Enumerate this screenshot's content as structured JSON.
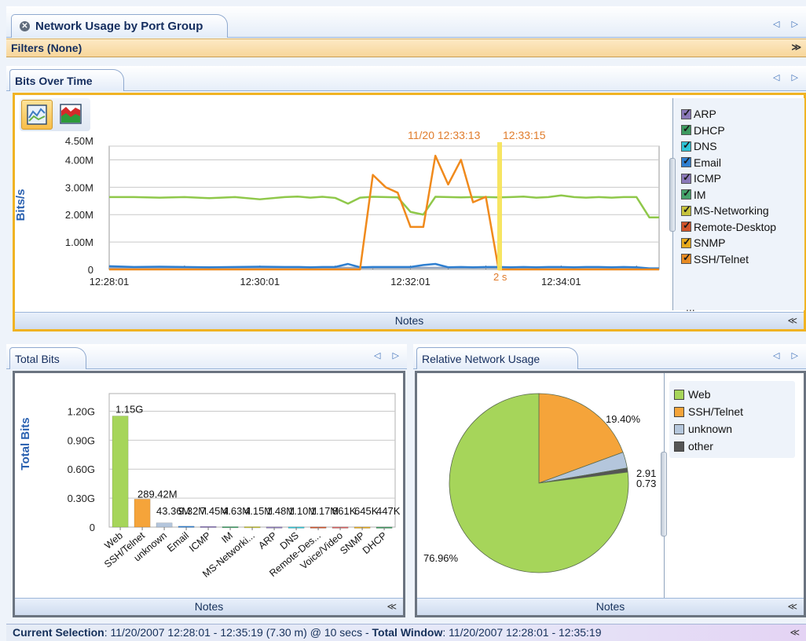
{
  "title_tab": {
    "label": "Network Usage by Port Group",
    "nav": "◁ ▷"
  },
  "filters": {
    "label": "Filters (None)",
    "expand_glyph": "≫"
  },
  "bits_over_time": {
    "tab_label": "Bits Over Time",
    "nav": "◁ ▷",
    "notes_label": "Notes",
    "legend": [
      {
        "label": "ARP",
        "color": "#8a78b8"
      },
      {
        "label": "DHCP",
        "color": "#3c9a5f"
      },
      {
        "label": "DNS",
        "color": "#2ec4d6"
      },
      {
        "label": "Email",
        "color": "#2f7fd0"
      },
      {
        "label": "ICMP",
        "color": "#8a78b8"
      },
      {
        "label": "IM",
        "color": "#45a36a"
      },
      {
        "label": "MS-Networking",
        "color": "#c6c23c"
      },
      {
        "label": "Remote-Desktop",
        "color": "#d0532a"
      },
      {
        "label": "SNMP",
        "color": "#e6a91c"
      },
      {
        "label": "SSH/Telnet",
        "color": "#e78a22"
      }
    ],
    "legend_more": "...",
    "cursor_time": "11/20 12:33:13",
    "cursor_time2": "12:33:15",
    "cursor_delta": "2 s"
  },
  "total_bits": {
    "tab_label": "Total Bits",
    "nav": "◁ ▷",
    "notes_label": "Notes"
  },
  "relative_usage": {
    "tab_label": "Relative Network Usage",
    "nav": "◁ ▷",
    "notes_label": "Notes",
    "legend": [
      {
        "label": "Web",
        "color": "#a6d55a"
      },
      {
        "label": "SSH/Telnet",
        "color": "#f5a43a"
      },
      {
        "label": "unknown",
        "color": "#b4c6dc"
      },
      {
        "label": "other",
        "color": "#555555"
      }
    ]
  },
  "status": {
    "current_label": "Current Selection",
    "current_value": ": 11/20/2007 12:28:01 - 12:35:19 (7.30 m) @ 10 secs - ",
    "total_label": "Total Window",
    "total_value": ": 11/20/2007 12:28:01 - 12:35:19"
  },
  "chart_data": [
    {
      "type": "line",
      "ylabel": "Bits/s",
      "x_ticks": [
        "12:28:01",
        "12:30:01",
        "12:32:01",
        "12:34:01"
      ],
      "y_ticks": [
        "0",
        "1.00M",
        "2.00M",
        "3.00M",
        "4.00M",
        "4.50M"
      ],
      "ylim": [
        0,
        4500000
      ],
      "x_minutes": [
        0,
        0.33,
        0.67,
        1.0,
        1.33,
        1.67,
        2.0,
        2.33,
        2.5,
        2.67,
        2.83,
        3.0,
        3.17,
        3.33,
        3.5,
        3.67,
        3.83,
        4.0,
        4.17,
        4.33,
        4.5,
        4.67,
        4.83,
        5.0,
        5.17,
        5.33,
        5.5,
        5.67,
        5.83,
        6.0,
        6.17,
        6.33,
        6.5,
        6.67,
        6.83,
        7.0,
        7.17,
        7.3
      ],
      "series": [
        {
          "name": "IM",
          "color": "#8fc84a",
          "values": [
            2640000,
            2640000,
            2620000,
            2640000,
            2600000,
            2640000,
            2560000,
            2640000,
            2660000,
            2620000,
            2650000,
            2610000,
            2400000,
            2620000,
            2650000,
            2640000,
            2630000,
            2100000,
            2000000,
            2650000,
            2640000,
            2630000,
            2640000,
            2640000,
            2630000,
            2640000,
            2660000,
            2620000,
            2640000,
            2700000,
            2640000,
            2620000,
            2640000,
            2620000,
            2640000,
            2640000,
            1900000,
            1900000
          ]
        },
        {
          "name": "SSH/Telnet",
          "color": "#f08a1c",
          "values": [
            0,
            0,
            0,
            0,
            0,
            0,
            0,
            0,
            0,
            0,
            0,
            0,
            0,
            0,
            3450000,
            3000000,
            2800000,
            1550000,
            1550000,
            4150000,
            3100000,
            4000000,
            2450000,
            2650000,
            0,
            0,
            0,
            0,
            0,
            0,
            0,
            0,
            0,
            0,
            0,
            0,
            0,
            0
          ]
        },
        {
          "name": "Email",
          "color": "#2f7fd0",
          "values": [
            120000,
            90000,
            100000,
            90000,
            80000,
            90000,
            100000,
            90000,
            90000,
            80000,
            90000,
            90000,
            200000,
            80000,
            90000,
            90000,
            90000,
            90000,
            160000,
            200000,
            80000,
            90000,
            80000,
            90000,
            90000,
            80000,
            90000,
            80000,
            90000,
            90000,
            80000,
            90000,
            90000,
            80000,
            90000,
            80000,
            40000,
            40000
          ]
        },
        {
          "name": "unknown",
          "color": "#9aa8bf",
          "values": [
            60000,
            60000,
            60000,
            60000,
            60000,
            60000,
            60000,
            60000,
            60000,
            60000,
            60000,
            60000,
            60000,
            60000,
            60000,
            60000,
            60000,
            60000,
            60000,
            60000,
            60000,
            60000,
            60000,
            60000,
            60000,
            60000,
            60000,
            60000,
            60000,
            60000,
            60000,
            60000,
            60000,
            60000,
            60000,
            60000,
            30000,
            30000
          ]
        }
      ]
    },
    {
      "type": "bar",
      "ylabel": "Total Bits",
      "y_ticks": [
        "0",
        "0.30G",
        "0.60G",
        "0.90G",
        "1.20G"
      ],
      "ylim": [
        0,
        1.35
      ],
      "categories": [
        "Web",
        "SSH/Telnet",
        "unknown",
        "Email",
        "ICMP",
        "IM",
        "MS-Networki...",
        "ARP",
        "DNS",
        "Remote-Des...",
        "Voice/Video",
        "SNMP",
        "DHCP"
      ],
      "values_g": [
        1.15,
        0.28942,
        0.04336,
        0.0093,
        0.0075,
        0.0046,
        0.0042,
        0.0015,
        0.0011,
        0.0012,
        0.0009,
        0.0006,
        0.0005
      ],
      "data_labels": [
        "1.15G",
        "289.42M",
        "43.36M",
        "9.32M",
        "7.45M",
        "4.63M",
        "4.15M",
        "1.48M",
        "1.10M",
        "1.17M",
        "861K",
        "645K",
        "447K"
      ],
      "colors": [
        "#a6d55a",
        "#f5a43a",
        "#b4c6dc",
        "#2f7fd0",
        "#8a78b8",
        "#45a36a",
        "#c6c23c",
        "#8a78b8",
        "#2ec4d6",
        "#d0532a",
        "#d86060",
        "#e6a91c",
        "#3c9a5f"
      ]
    },
    {
      "type": "pie",
      "slices": [
        {
          "label": "Web",
          "value": 76.96,
          "text": "76.96%",
          "color": "#a6d55a"
        },
        {
          "label": "SSH/Telnet",
          "value": 19.4,
          "text": "19.40%",
          "color": "#f5a43a"
        },
        {
          "label": "unknown",
          "value": 2.91,
          "text": "2.91",
          "color": "#b4c6dc"
        },
        {
          "label": "other",
          "value": 0.73,
          "text": "0.73",
          "color": "#555555"
        }
      ]
    }
  ]
}
